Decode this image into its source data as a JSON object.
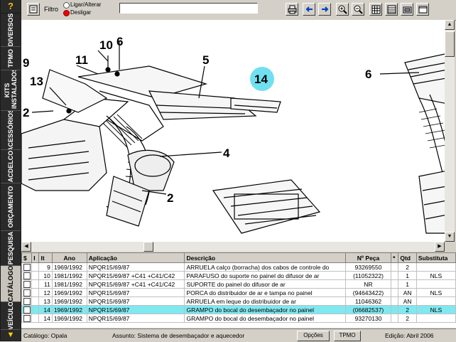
{
  "sidebar": {
    "help": "?",
    "tabs": [
      "DIVERSOS",
      "TPMO",
      "KITS INSTALADOS",
      "ACESSÓRIOS",
      "ACDELCO",
      "ORÇAMENTO",
      "PESQUISA",
      "CATÁLOGO",
      "VEÍCULO"
    ],
    "active_tab": "CATÁLOGO"
  },
  "toolbar": {
    "filter_label": "Filtro",
    "radio_on": "Ligar/Alterar",
    "radio_off": "Desligar",
    "filter_value": ""
  },
  "drawing": {
    "callouts": [
      "10",
      "6",
      "11",
      "5",
      "9",
      "13",
      "14",
      "6",
      "2",
      "4",
      "2"
    ]
  },
  "table": {
    "headers": [
      "$",
      "I",
      "It",
      "Ano",
      "Aplicação",
      "Descrição",
      "Nº Peça",
      "*",
      "Qtd",
      "Substituta"
    ],
    "rows": [
      {
        "it": "9",
        "ano": "1969/1992",
        "aplicacao": "NPQR15/69/87",
        "descricao": "ARRUELA calço (borracha) dos cabos de controle do",
        "peca": "93269550",
        "star": "",
        "qtd": "2",
        "subst": ""
      },
      {
        "it": "10",
        "ano": "1981/1992",
        "aplicacao": "NPQR15/69/87 +C41 +C41/C42",
        "descricao": "PARAFUSO do suporte no painel do difusor de ar",
        "peca": "(11052322)",
        "star": "",
        "qtd": "1",
        "subst": "NLS"
      },
      {
        "it": "11",
        "ano": "1981/1992",
        "aplicacao": "NPQR15/69/87 +C41 +C41/C42",
        "descricao": "SUPORTE do painel do difusor de ar",
        "peca": "NR",
        "star": "",
        "qtd": "1",
        "subst": ""
      },
      {
        "it": "12",
        "ano": "1969/1992",
        "aplicacao": "NPQR15/69/87",
        "descricao": "PORCA do distribuidor de ar e tampa no painel",
        "peca": "(94643422)",
        "star": "",
        "qtd": "AN",
        "subst": "NLS"
      },
      {
        "it": "13",
        "ano": "1969/1992",
        "aplicacao": "NPQR15/69/87",
        "descricao": "ARRUELA em leque do distribuidor de ar",
        "peca": "11046362",
        "star": "",
        "qtd": "AN",
        "subst": ""
      },
      {
        "it": "14",
        "ano": "1969/1992",
        "aplicacao": "NPQR15/69/87",
        "descricao": "GRAMPO do bocal do desembaçador no painel",
        "peca": "(06682537)",
        "star": "",
        "qtd": "2",
        "subst": "NLS"
      },
      {
        "it": "14",
        "ano": "1969/1992",
        "aplicacao": "NPQR15/69/87",
        "descricao": "GRAMPO do bocal do desembaçador no painel",
        "peca": "93270130",
        "star": "",
        "qtd": "2",
        "subst": ""
      }
    ],
    "selected_row": 5
  },
  "status": {
    "catalogo": "Catálogo: Opala",
    "assunto": "Assunto: Sistema de desembaçador e aquecedor",
    "opcoes": "Opções",
    "tpmo": "TPMO",
    "edicao": "Edição: Abril 2006"
  },
  "colors": {
    "sidebar_bg": "#1b1b1b",
    "selection": "#7fe8f0",
    "callout_highlight": "#70e0f0"
  },
  "icons": [
    "printer-icon",
    "arrow-left-icon",
    "arrow-right-icon",
    "zoom-in-icon",
    "zoom-out-icon",
    "grid-icon",
    "table-icon",
    "window-icon",
    "window-alt-icon"
  ]
}
